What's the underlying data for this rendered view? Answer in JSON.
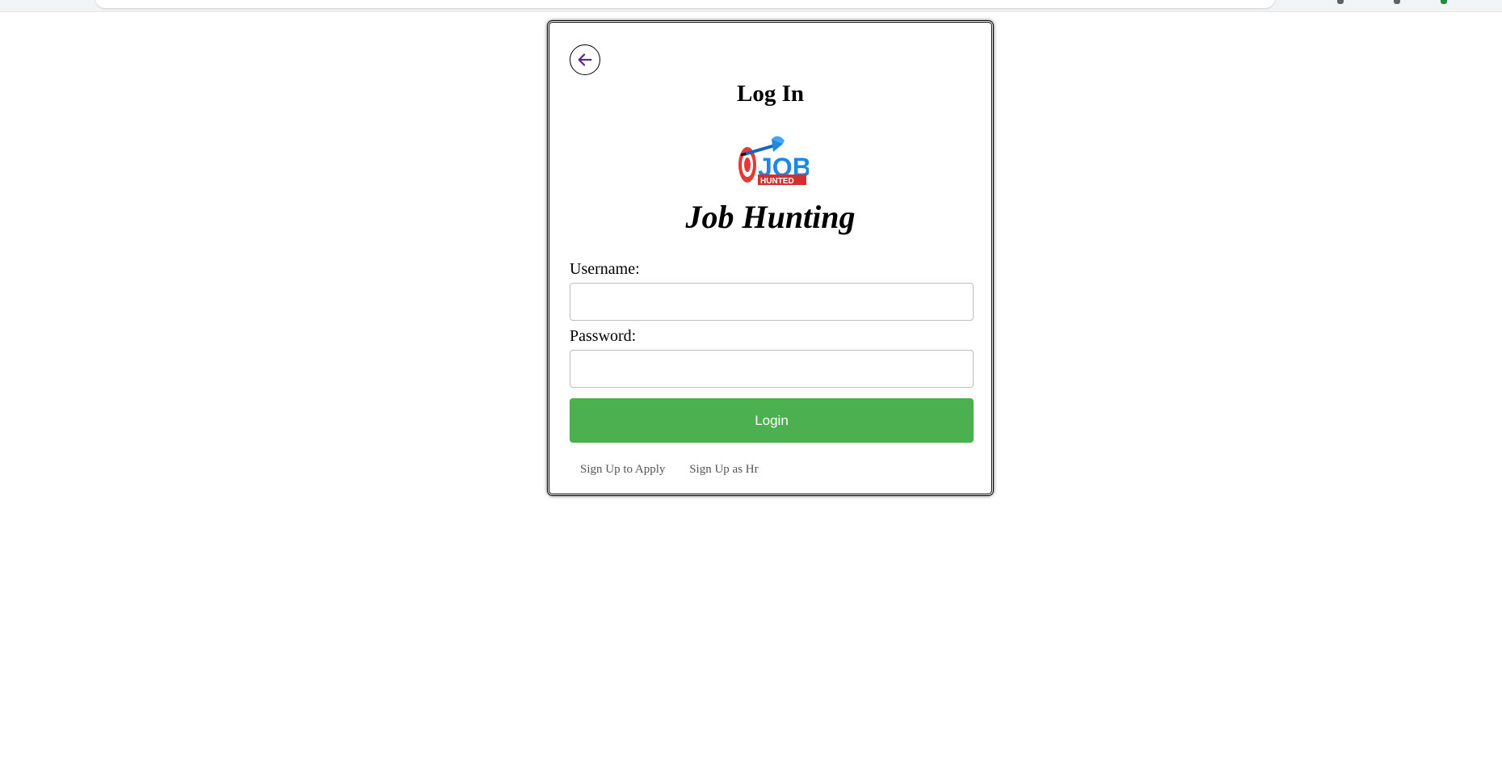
{
  "page": {
    "title": "Log In",
    "brand": "Job Hunting",
    "logo_icon": "job-dart-target-logo"
  },
  "form": {
    "username_label": "Username:",
    "username_value": "",
    "password_label": "Password:",
    "password_value": "",
    "login_label": "Login"
  },
  "links": {
    "signup_apply": "Sign Up to Apply",
    "signup_hr": "Sign Up as Hr"
  },
  "icons": {
    "back": "arrow-left-icon"
  },
  "colors": {
    "login_button": "#4caf50",
    "back_arrow": "#5b2a8a",
    "link_text": "#555555"
  }
}
